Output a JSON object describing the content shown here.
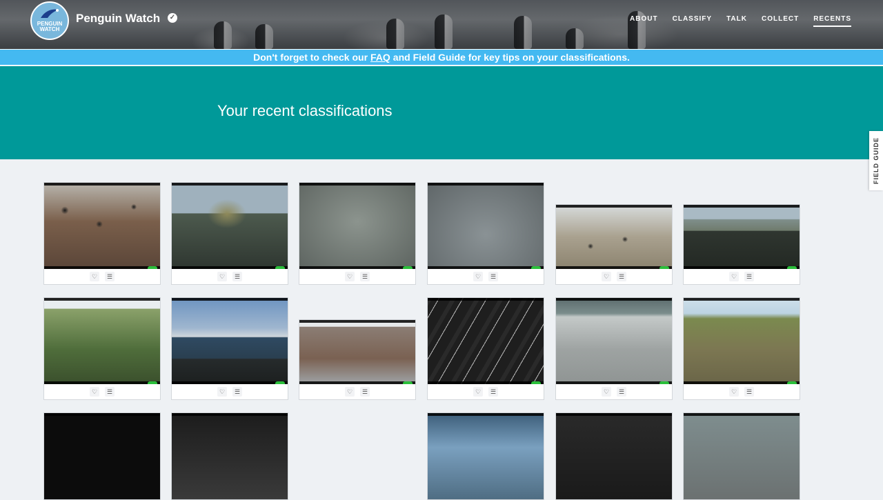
{
  "header": {
    "logo_text": "PENGUIN WATCH",
    "project_name": "Penguin Watch",
    "nav": [
      {
        "label": "ABOUT"
      },
      {
        "label": "CLASSIFY"
      },
      {
        "label": "TALK"
      },
      {
        "label": "COLLECT"
      },
      {
        "label": "RECENTS",
        "active": true
      }
    ]
  },
  "banner": {
    "prefix": "Don't forget to check our",
    "faq_link": "FAQ",
    "suffix": "and Field Guide for key tips on your classifications."
  },
  "hero": {
    "title": "Your recent classifications"
  },
  "field_guide_tab": "FIELD GUIDE",
  "icons": {
    "favorite": "heart-icon",
    "collect": "list-icon",
    "verified": "check-badge-icon"
  },
  "colors": {
    "hero": "#009999",
    "banner": "#44b9f1"
  }
}
